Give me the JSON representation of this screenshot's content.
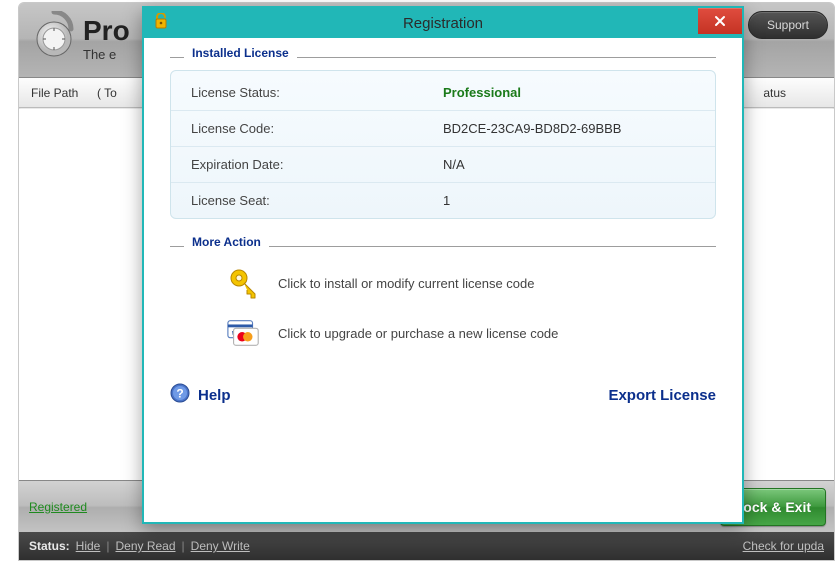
{
  "bg": {
    "title_prefix": "Pro",
    "subtitle_prefix": "The e",
    "support": "Support",
    "table": {
      "file_path": "File Path",
      "to": "( To",
      "status": "atus"
    },
    "registered": "Registered",
    "lock_exit": "Lock & Exit",
    "statusbar": {
      "label": "Status:",
      "hide": "Hide",
      "deny_read": "Deny Read",
      "deny_write": "Deny Write",
      "check_update": "Check for upda"
    }
  },
  "dialog": {
    "title": "Registration",
    "group_installed": "Installed License",
    "group_more": "More Action",
    "rows": {
      "status_label": "License Status:",
      "status_value": "Professional",
      "code_label": "License Code:",
      "code_value": "BD2CE-23CA9-BD8D2-69BBB",
      "exp_label": "Expiration Date:",
      "exp_value": "N/A",
      "seat_label": "License Seat:",
      "seat_value": "1"
    },
    "action_install": "Click to install or modify current license code",
    "action_upgrade": "Click to upgrade or purchase a new license code",
    "help": "Help",
    "export": "Export License"
  }
}
